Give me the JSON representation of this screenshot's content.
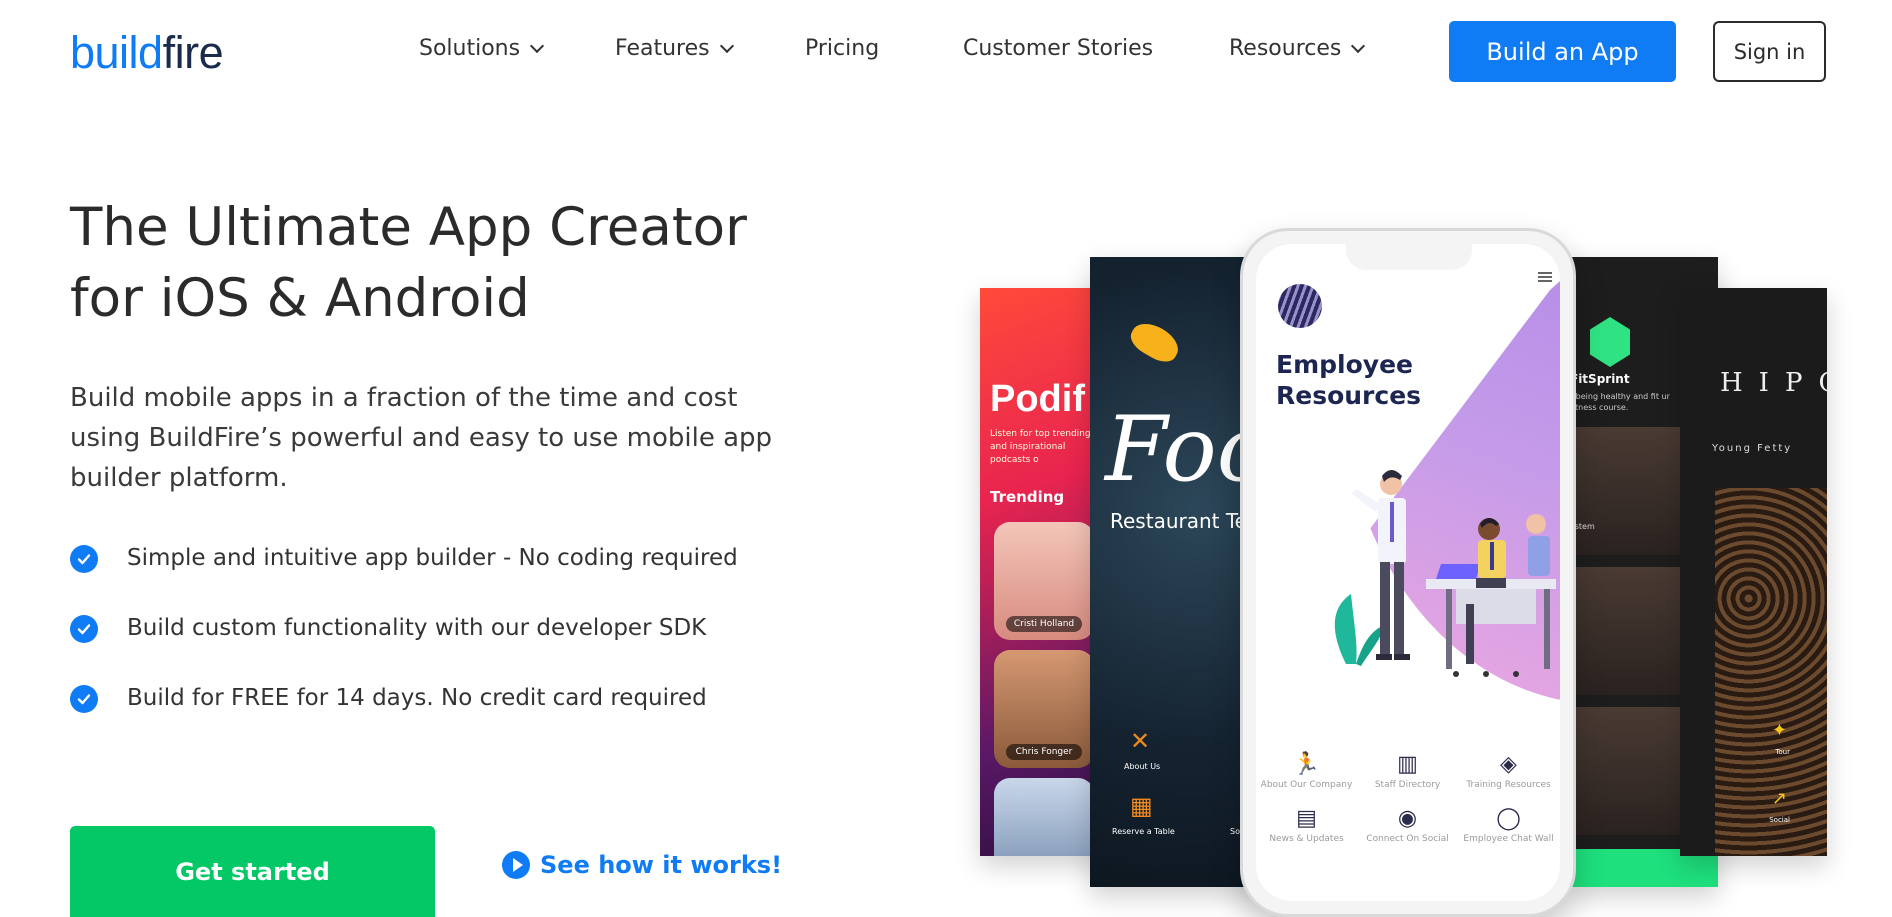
{
  "nav": {
    "logo_part1": "build",
    "logo_part2": "fire",
    "items": [
      {
        "label": "Solutions",
        "dropdown": true
      },
      {
        "label": "Features",
        "dropdown": true
      },
      {
        "label": "Pricing",
        "dropdown": false
      },
      {
        "label": "Customer Stories",
        "dropdown": false
      },
      {
        "label": "Resources",
        "dropdown": true
      }
    ],
    "cta": "Build an App",
    "signin": "Sign in"
  },
  "hero": {
    "title_line1": "The Ultimate App Creator",
    "title_line2": "for iOS & Android",
    "description": "Build mobile apps in a fraction of the time and cost using BuildFire’s powerful and easy to use mobile app builder platform.",
    "features": [
      "Simple and intuitive app builder - No coding required",
      "Build custom functionality with our developer SDK",
      "Build for FREE for 14 days. No credit card required"
    ],
    "get_started": "Get started",
    "see_how": "See how it works!"
  },
  "screens": {
    "podify": {
      "title": "Podif",
      "subtitle": "Listen for top trending and inspirational podcasts o",
      "section": "Trending",
      "people": [
        "Cristi Holland",
        "Chris Fonger"
      ]
    },
    "food": {
      "title": "Foo",
      "subtitle": "Restaurant Te",
      "items": [
        "About Us",
        "Reserve a Table",
        "Social G"
      ]
    },
    "center": {
      "title_line1": "Employee",
      "title_line2": "Resources",
      "grid": [
        {
          "label": "About Our Company",
          "icon": "runner-icon"
        },
        {
          "label": "Staff Directory",
          "icon": "directory-icon"
        },
        {
          "label": "Training Resources",
          "icon": "layers-icon"
        },
        {
          "label": "News & Updates",
          "icon": "news-icon"
        },
        {
          "label": "Connect On Social",
          "icon": "broadcast-icon"
        },
        {
          "label": "Employee Chat Wall",
          "icon": "chat-icon"
        }
      ]
    },
    "fit": {
      "title": "FitSprint",
      "subtitle": "t being healthy and fit ur fitness course.",
      "tag": "ystem"
    },
    "hop": {
      "logo": "HIPO",
      "subtitle": "Young Fetty",
      "items": [
        "Tour",
        "Social"
      ]
    }
  },
  "colors": {
    "primary": "#0f7bf5",
    "green": "#04c866",
    "text": "#2b2b2b"
  }
}
